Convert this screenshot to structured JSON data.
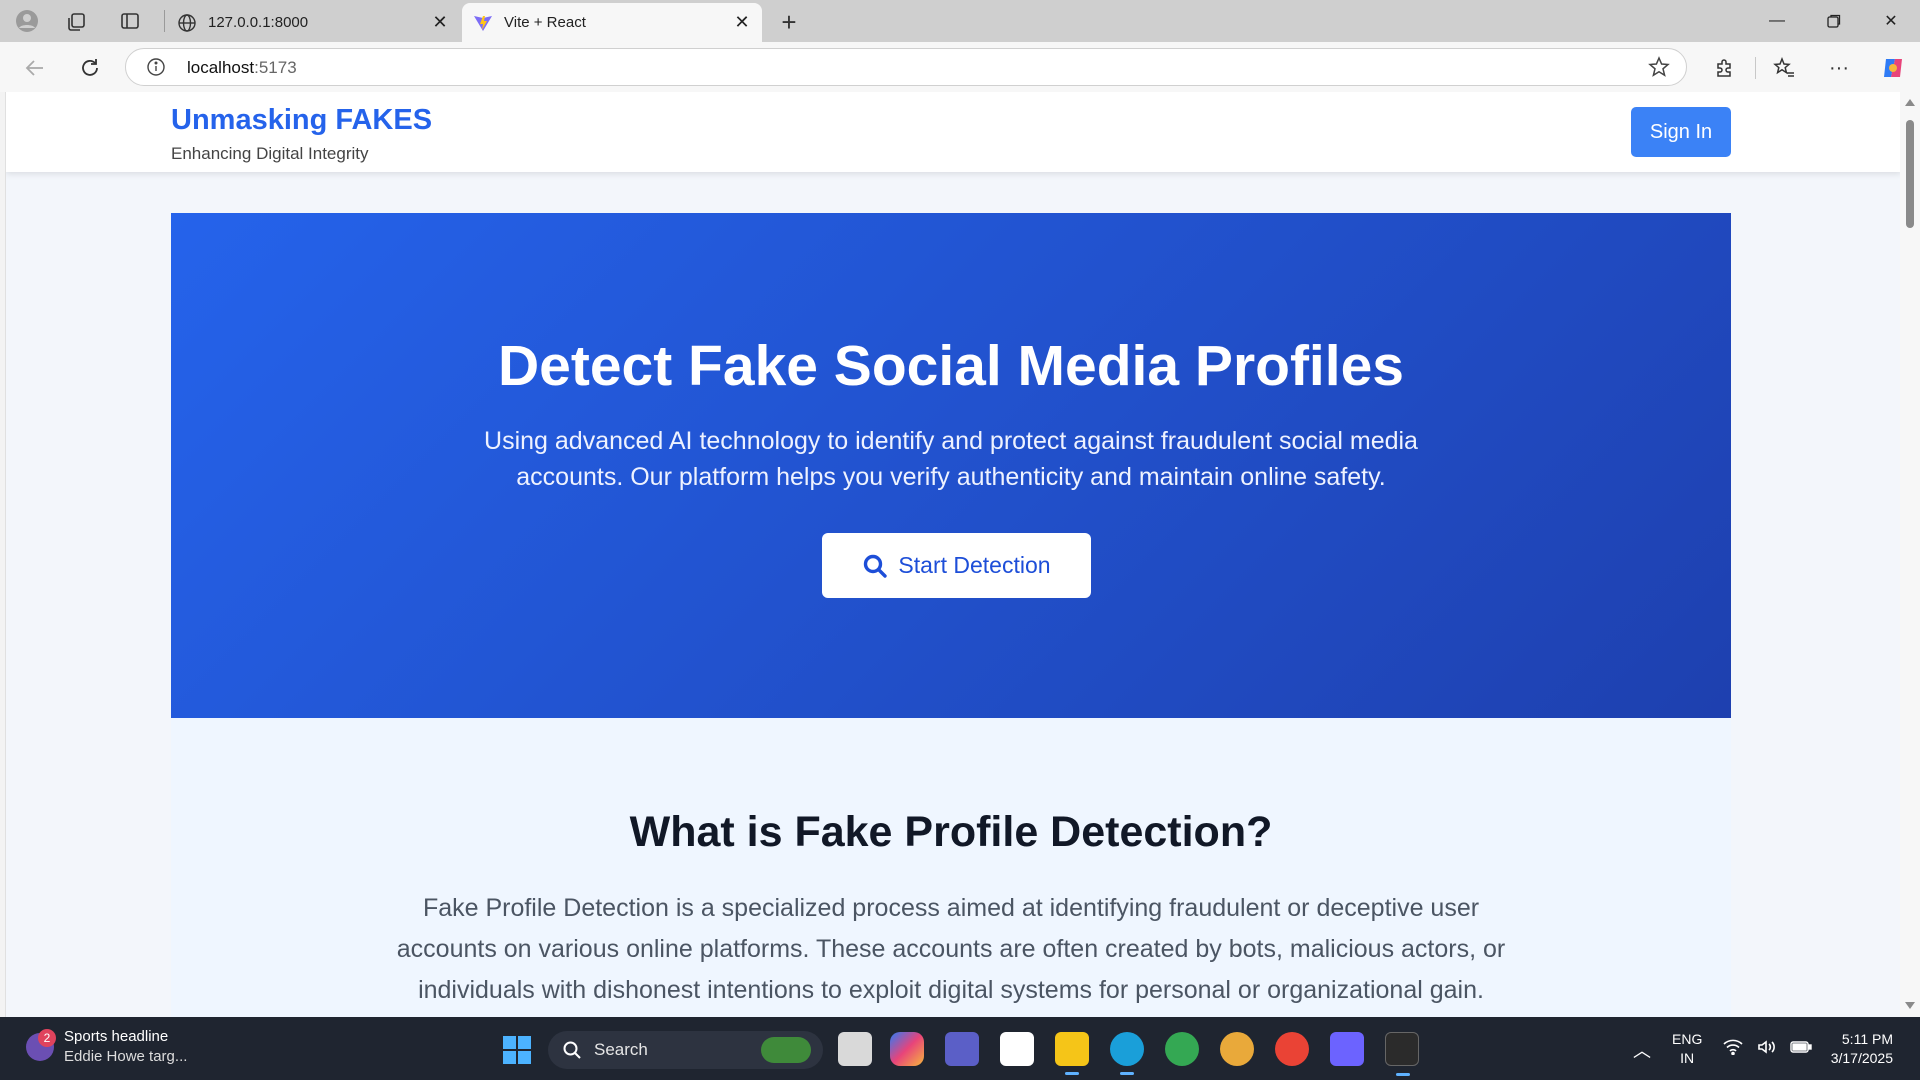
{
  "browser": {
    "tabs": [
      {
        "title": "127.0.0.1:8000",
        "icon": "globe-icon",
        "active": false
      },
      {
        "title": "Vite + React",
        "icon": "vite-icon",
        "active": true
      }
    ],
    "url_host": "localhost",
    "url_port": ":5173"
  },
  "site": {
    "brand_title": "Unmasking FAKES",
    "brand_subtitle": "Enhancing Digital Integrity",
    "signin_label": "Sign In"
  },
  "hero": {
    "title": "Detect Fake Social Media Profiles",
    "description": "Using advanced AI technology to identify and protect against fraudulent social media accounts. Our platform helps you verify authenticity and maintain online safety.",
    "cta_label": "Start Detection"
  },
  "about": {
    "title": "What is Fake Profile Detection?",
    "description": "Fake Profile Detection is a specialized process aimed at identifying fraudulent or deceptive user accounts on various online platforms. These accounts are often created by bots, malicious actors, or individuals with dishonest intentions to exploit digital systems for personal or organizational gain."
  },
  "taskbar": {
    "news_badge": "2",
    "news_title": "Sports headline",
    "news_text": "Eddie Howe targ...",
    "search_label": "Search",
    "lang_line1": "ENG",
    "lang_line2": "IN",
    "time": "5:11 PM",
    "date": "3/17/2025"
  },
  "colors": {
    "brand": "#2563eb",
    "hero_start": "#2563eb",
    "hero_end": "#1e40af",
    "signin_bg": "#3b82f6",
    "about_bg": "#eff6ff"
  }
}
